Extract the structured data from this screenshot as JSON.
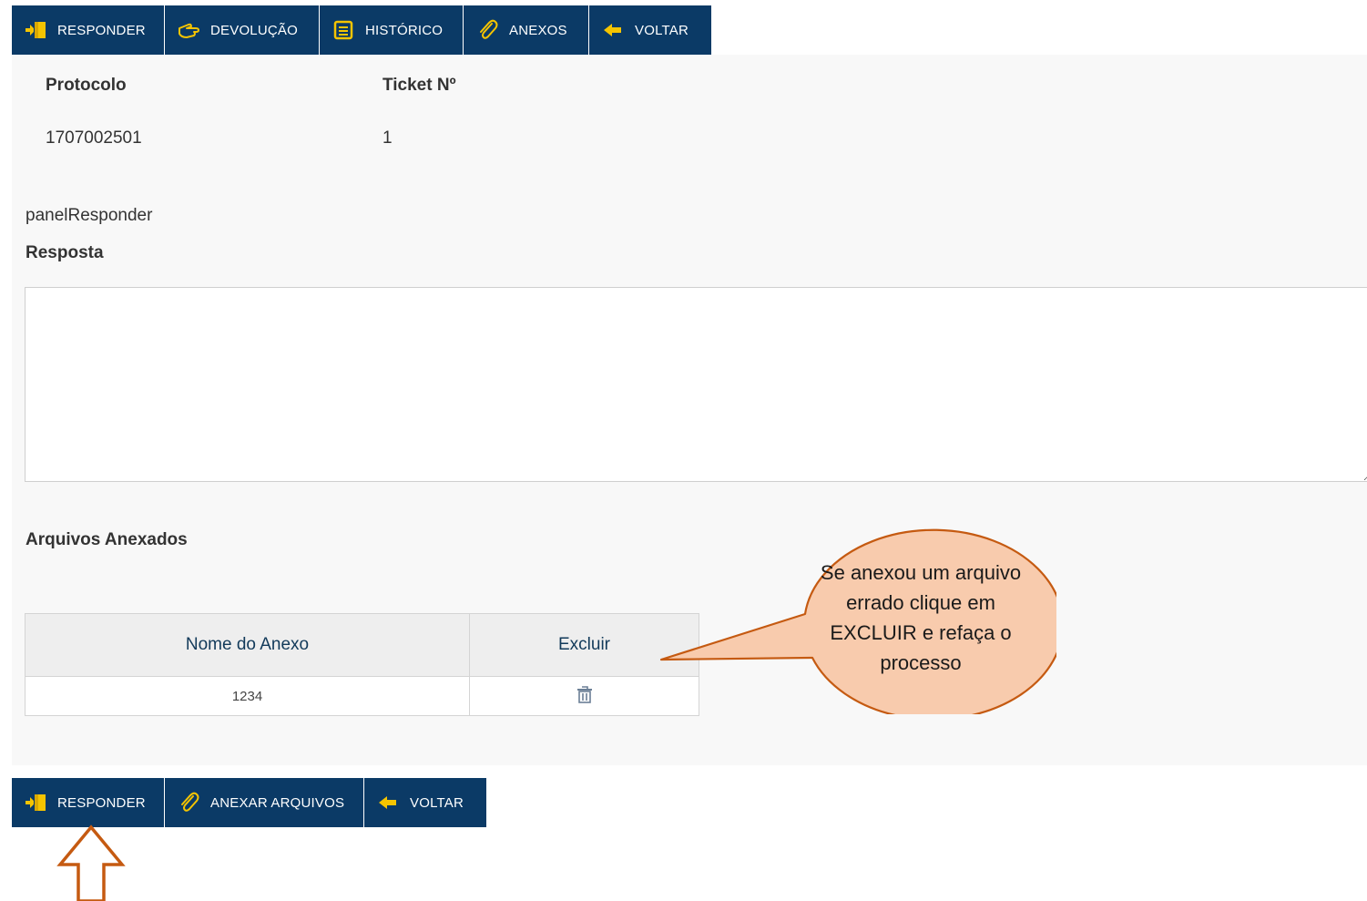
{
  "top_toolbar": {
    "buttons": [
      {
        "label": "RESPONDER",
        "icon": "responder-icon"
      },
      {
        "label": "DEVOLUÇÃO",
        "icon": "hand-point-icon"
      },
      {
        "label": "HISTÓRICO",
        "icon": "list-document-icon"
      },
      {
        "label": "ANEXOS",
        "icon": "paperclip-icon"
      },
      {
        "label": "VOLTAR",
        "icon": "arrow-left-icon"
      }
    ]
  },
  "ticket": {
    "protocolo_label": "Protocolo",
    "ticket_label": "Ticket Nº",
    "protocolo_value": "1707002501",
    "ticket_value": "1"
  },
  "panel_name": "panelResponder",
  "resposta": {
    "label": "Resposta",
    "value": ""
  },
  "arquivos": {
    "label": "Arquivos Anexados",
    "columns": [
      "Nome do Anexo",
      "Excluir"
    ],
    "rows": [
      {
        "nome": "1234",
        "excluir_icon": "trash-icon"
      }
    ]
  },
  "callout": {
    "text": "Se anexou um arquivo errado clique em EXCLUIR e refaça o processo"
  },
  "bottom_toolbar": {
    "buttons": [
      {
        "label": "RESPONDER",
        "icon": "responder-icon"
      },
      {
        "label": "ANEXAR ARQUIVOS",
        "icon": "paperclip-icon"
      },
      {
        "label": "VOLTAR",
        "icon": "arrow-left-icon"
      }
    ]
  },
  "colors": {
    "toolbar_bg": "#0b3a66",
    "icon_yellow": "#f5c400",
    "callout_fill": "#f8cbad",
    "callout_stroke": "#c55a11",
    "arrow_stroke": "#c55a11"
  }
}
